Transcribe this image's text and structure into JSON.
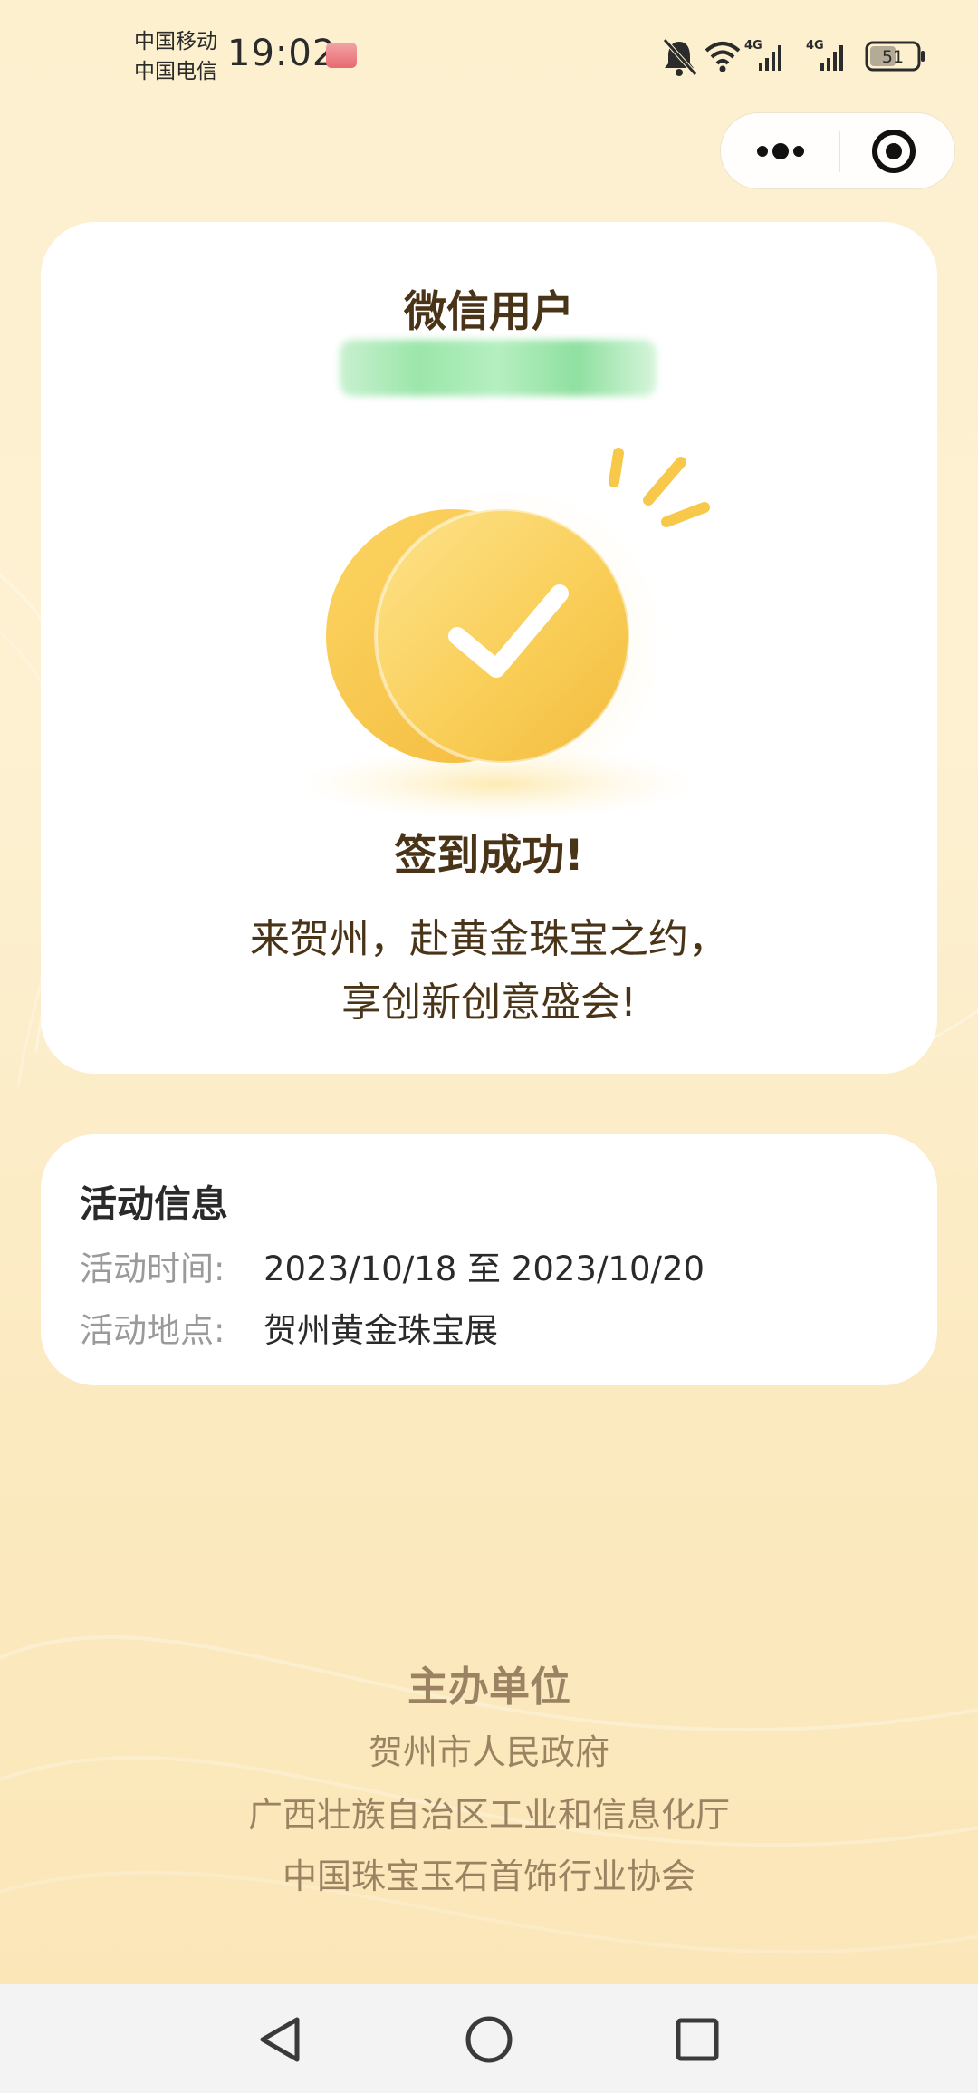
{
  "status_bar": {
    "carrier_1": "中国移动",
    "carrier_2": "中国电信",
    "time": "19:02",
    "network_1": "4G",
    "network_2": "4G",
    "battery": "51"
  },
  "capsule": {
    "more_icon": "more-dots-icon",
    "close_icon": "target-close-icon"
  },
  "user": {
    "name": "微信用户"
  },
  "checkin": {
    "title": "签到成功!",
    "message_line_1": "来贺州，赴黄金珠宝之约，",
    "message_line_2": "享创新创意盛会!"
  },
  "activity": {
    "section_title": "活动信息",
    "time_label": "活动时间:",
    "time_value": "2023/10/18 至 2023/10/20",
    "place_label": "活动地点:",
    "place_value": "贺州黄金珠宝展"
  },
  "organizers": {
    "title": "主办单位",
    "items": [
      "贺州市人民政府",
      "广西壮族自治区工业和信息化厅",
      "中国珠宝玉石首饰行业协会"
    ]
  },
  "colors": {
    "accent_gold": "#f7c84a",
    "text_brown": "#4a3418",
    "organizer_text": "#9b8263"
  }
}
